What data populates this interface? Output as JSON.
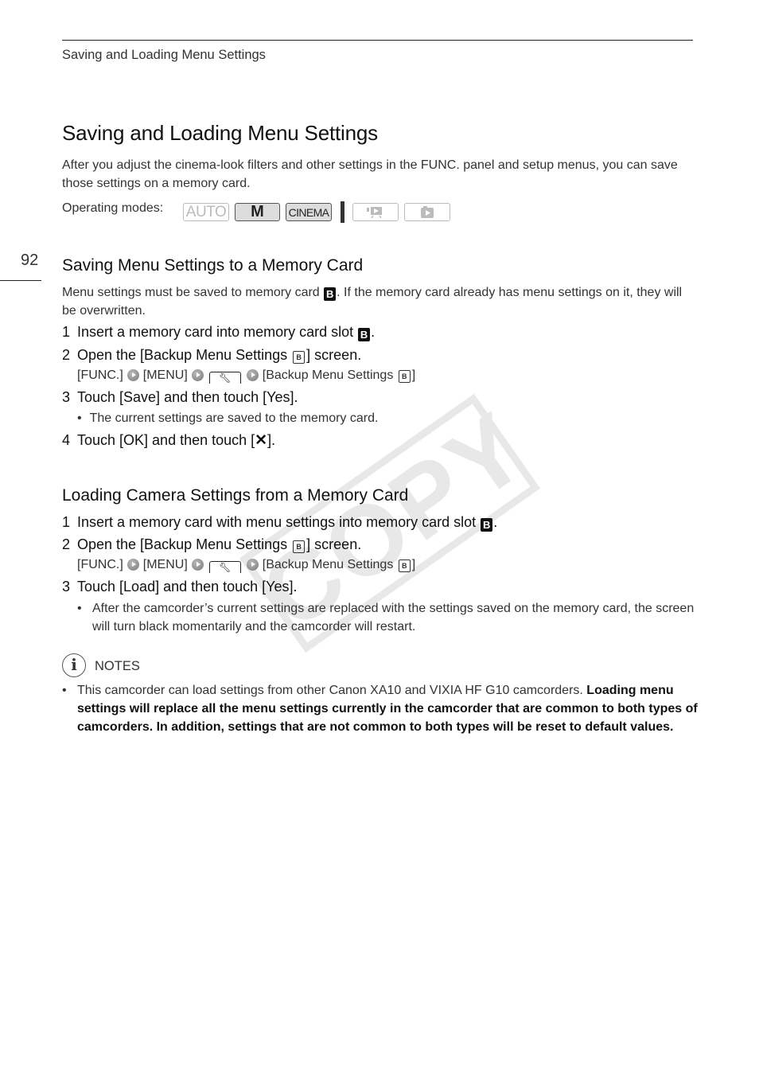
{
  "header": {
    "running_head": "Saving and Loading Menu Settings",
    "page_number": "92"
  },
  "page": {
    "title": "Saving and Loading Menu Settings",
    "intro": "After you adjust the cinema-look filters and other settings in the FUNC. panel and setup menus, you can save those settings on a memory card.",
    "operating_modes_label": "Operating modes:",
    "modes": [
      {
        "label": "AUTO",
        "state": "unavailable"
      },
      {
        "label": "M",
        "state": "available"
      },
      {
        "label": "CINEMA",
        "state": "available"
      },
      {
        "label": "video-playback-icon",
        "state": "unavailable"
      },
      {
        "label": "photo-playback-icon",
        "state": "unavailable"
      }
    ]
  },
  "section1": {
    "title": "Saving Menu Settings to a Memory Card",
    "intro_before": "Menu settings must be saved to memory card ",
    "card_letter": "B",
    "intro_after": ". If the memory card already has menu settings on it, they will be overwritten.",
    "steps": [
      {
        "num": "1",
        "before": "Insert a memory card into memory card slot ",
        "after": "."
      },
      {
        "num": "2",
        "before": "Open the [Backup Menu Settings ",
        "after": "] screen."
      },
      {
        "num": "3",
        "text": "Touch [Save] and then touch [Yes]."
      },
      {
        "num": "4",
        "before": "Touch [OK] and then touch [",
        "glyph": "✕",
        "after": "]."
      }
    ],
    "path": {
      "func": "[FUNC.]",
      "menu": "[MENU]",
      "tab_icon": "wrench-icon",
      "target_before": "[Backup Menu Settings ",
      "target_after": "]"
    },
    "bullet": "The current settings are saved to the memory card."
  },
  "section2": {
    "title": "Loading Camera Settings from a Memory Card",
    "steps": [
      {
        "num": "1",
        "before": "Insert a memory card with menu settings into memory card slot ",
        "after": "."
      },
      {
        "num": "2",
        "before": "Open the [Backup Menu Settings ",
        "after": "] screen."
      },
      {
        "num": "3",
        "text": "Touch [Load] and then touch [Yes]."
      }
    ],
    "path": {
      "func": "[FUNC.]",
      "menu": "[MENU]",
      "target_before": "[Backup Menu Settings ",
      "target_after": "]"
    },
    "bullet": "After the camcorder’s current settings are replaced with the settings saved on the memory card, the screen will turn black momentarily and the camcorder will restart."
  },
  "notes": {
    "label": "NOTES",
    "icon_letter": "i",
    "bullet_normal": "This camcorder can load settings from other Canon XA10 and VIXIA HF G10 camcorders. ",
    "bullet_bold": "Loading menu settings will replace all the menu settings currently in the camcorder that are common to both types of camcorders. In addition, settings that are not common to both types will be reset to default values."
  },
  "watermark": "COPY"
}
